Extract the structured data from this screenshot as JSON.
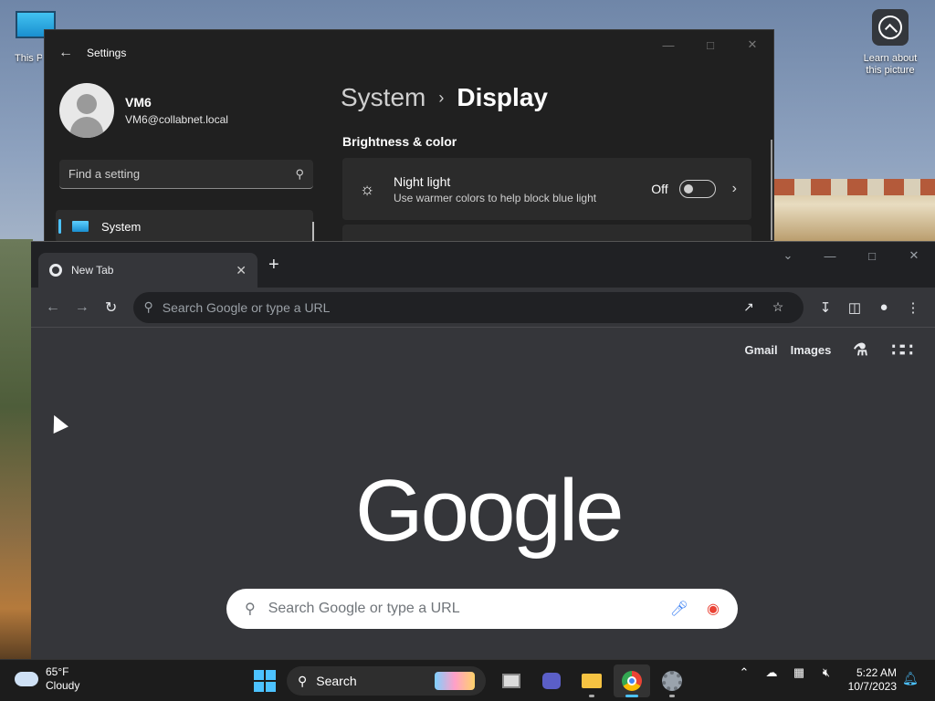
{
  "desktop": {
    "icon_label": "This PC",
    "learn_label": "Learn about this picture"
  },
  "settings": {
    "app_title": "Settings",
    "user_name": "VM6",
    "user_email": "VM6@collabnet.local",
    "search_placeholder": "Find a setting",
    "nav_selected": "System",
    "breadcrumb_parent": "System",
    "breadcrumb_current": "Display",
    "section_title": "Brightness & color",
    "night_light": {
      "title": "Night light",
      "description": "Use warmer colors to help block blue light",
      "state": "Off"
    }
  },
  "chrome": {
    "tab_title": "New Tab",
    "omnibox_placeholder": "Search Google or type a URL",
    "links": [
      "Gmail",
      "Images"
    ],
    "logo_text": "Google",
    "search_placeholder": "Search Google or type a URL"
  },
  "taskbar": {
    "weather_temp": "65°F",
    "weather_desc": "Cloudy",
    "search_label": "Search",
    "time": "5:22 AM",
    "date": "10/7/2023"
  },
  "colors": {
    "accent": "#4cc2ff",
    "settings_bg": "#202020",
    "chrome_bg": "#35363a"
  }
}
